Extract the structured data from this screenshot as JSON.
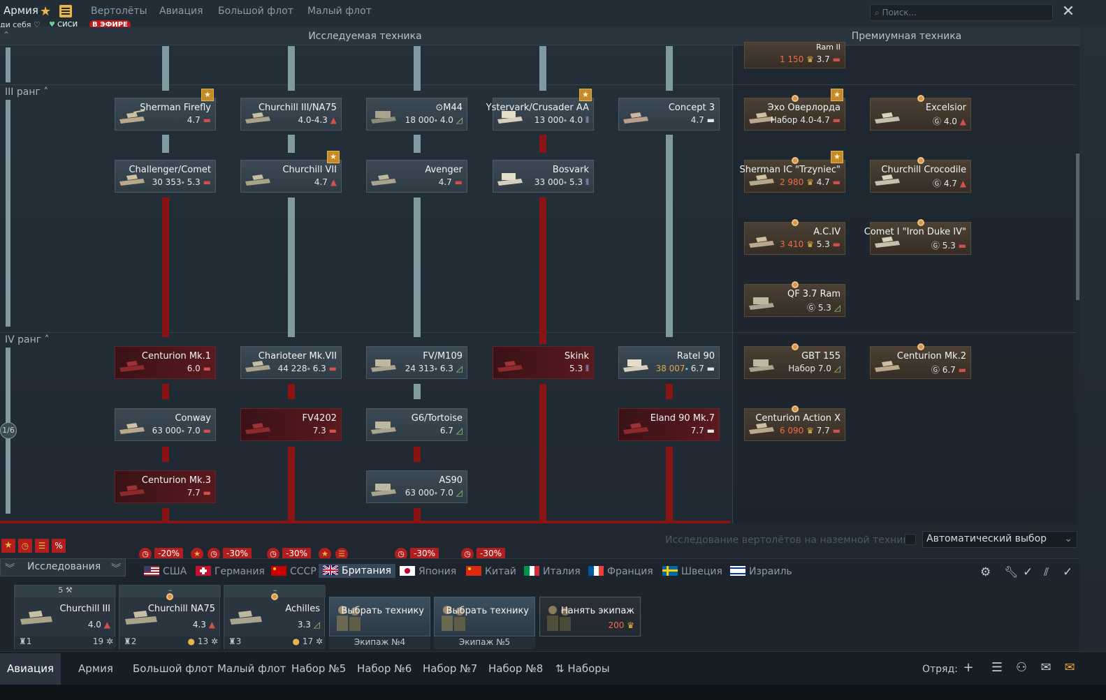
{
  "topbar": {
    "title": "Армия",
    "tabs": [
      "Вертолёты",
      "Авиация",
      "Большой флот",
      "Малый флот"
    ],
    "sub_left": "ди себя ♡",
    "chip_label": "СИСИ",
    "live_label": "В ЭФИРЕ",
    "search_placeholder": "Поиск..."
  },
  "headers": {
    "research": "Исследуемая техника",
    "premium": "Премиумная техника"
  },
  "ranks": {
    "r3": "III ранг",
    "r4": "IV ранг",
    "page_marker": "1/6"
  },
  "tree": [
    {
      "id": "firefly",
      "name": "Sherman Firefly",
      "cost": "",
      "br": "4.7",
      "state": "researched",
      "fav": true
    },
    {
      "id": "churchill3na75",
      "name": "Churchill III/NA75",
      "cost": "",
      "br": "4.0-4.3",
      "state": "researched"
    },
    {
      "id": "m44",
      "name": "M44",
      "cost": "18 000",
      "br": "4.0",
      "state": "normal"
    },
    {
      "id": "ystervark",
      "name": "Ystervark/Crusader AA",
      "cost": "13 000",
      "br": "4.0",
      "state": "normal",
      "fav": true
    },
    {
      "id": "concept3",
      "name": "Concept 3",
      "cost": "",
      "br": "4.7",
      "state": "researched"
    },
    {
      "id": "challenger",
      "name": "Challenger/Comet",
      "cost": "30 353",
      "br": "5.3",
      "state": "normal"
    },
    {
      "id": "churchill7",
      "name": "Churchill VII",
      "cost": "",
      "br": "4.7",
      "state": "researched",
      "fav": true
    },
    {
      "id": "avenger",
      "name": "Avenger",
      "cost": "",
      "br": "4.7",
      "state": "researched"
    },
    {
      "id": "bosvark",
      "name": "Bosvark",
      "cost": "33 000",
      "br": "5.3",
      "state": "normal"
    },
    {
      "id": "centurion1",
      "name": "Centurion Mk.1",
      "cost": "",
      "br": "6.0",
      "state": "locked"
    },
    {
      "id": "charioteer",
      "name": "Charioteer Mk.VII",
      "cost": "44 228",
      "br": "6.3",
      "state": "normal"
    },
    {
      "id": "fvm109",
      "name": "FV/M109",
      "cost": "24 313",
      "br": "6.3",
      "state": "normal"
    },
    {
      "id": "skink",
      "name": "Skink",
      "cost": "",
      "br": "5.3",
      "state": "locked"
    },
    {
      "id": "ratel90",
      "name": "Ratel 90",
      "cost": "38 007",
      "br": "6.7",
      "state": "normal"
    },
    {
      "id": "conway",
      "name": "Conway",
      "cost": "63 000",
      "br": "7.0",
      "state": "normal"
    },
    {
      "id": "fv4202",
      "name": "FV4202",
      "cost": "",
      "br": "7.3",
      "state": "locked"
    },
    {
      "id": "g6",
      "name": "G6/Tortoise",
      "cost": "",
      "br": "6.7",
      "state": "researched"
    },
    {
      "id": "eland",
      "name": "Eland 90 Mk.7",
      "cost": "",
      "br": "7.7",
      "state": "locked"
    },
    {
      "id": "centurion3",
      "name": "Centurion Mk.3",
      "cost": "",
      "br": "7.7",
      "state": "locked"
    },
    {
      "id": "as90",
      "name": "AS90",
      "cost": "63 000",
      "br": "7.0",
      "state": "normal"
    }
  ],
  "premium": [
    {
      "id": "ramii",
      "name": "Ram II",
      "cost": "1 150",
      "br": "3.7"
    },
    {
      "id": "echo",
      "name": "Эхо Оверлорда",
      "cost": "Набор",
      "br": "4.0-4.7",
      "fav": true
    },
    {
      "id": "excelsior",
      "name": "Excelsior",
      "cost": "Ⓖ",
      "br": "4.0"
    },
    {
      "id": "trzyniec",
      "name": "Sherman IC \"Trzyniec\"",
      "cost": "2 980",
      "br": "4.7",
      "fav": true
    },
    {
      "id": "crocodile",
      "name": "Churchill Crocodile",
      "cost": "Ⓖ",
      "br": "4.7"
    },
    {
      "id": "aciv",
      "name": "A.C.IV",
      "cost": "3 410",
      "br": "5.3"
    },
    {
      "id": "comet1",
      "name": "Comet I \"Iron Duke IV\"",
      "cost": "Ⓖ",
      "br": "5.3"
    },
    {
      "id": "qf37",
      "name": "QF 3.7 Ram",
      "cost": "Ⓖ",
      "br": "5.3"
    },
    {
      "id": "gbt155",
      "name": "GBT 155",
      "cost": "Набор",
      "br": "7.0"
    },
    {
      "id": "centurion2",
      "name": "Centurion Mk.2",
      "cost": "Ⓖ",
      "br": "6.7"
    },
    {
      "id": "actionx",
      "name": "Centurion Action X",
      "cost": "6 090",
      "br": "7.7"
    }
  ],
  "research_bar": {
    "auto_label": "Исследование вертолётов на наземной технике",
    "auto_select": "Автоматический выбор",
    "research_button": "Исследования"
  },
  "discounts": [
    "-20%",
    "-30%",
    "-30%",
    "-30%",
    "-30%"
  ],
  "nations": [
    "США",
    "Германия",
    "СССР",
    "Британия",
    "Япония",
    "Китай",
    "Италия",
    "Франция",
    "Швеция",
    "Израиль"
  ],
  "active_nation": "Британия",
  "crew_slots": [
    {
      "name": "Churchill III",
      "br": "4.0",
      "crew": "1",
      "top": "5",
      "count": "19"
    },
    {
      "name": "Churchill NA75",
      "br": "4.3",
      "crew": "2",
      "top": "–",
      "count": "13"
    },
    {
      "name": "Achilles",
      "br": "3.3",
      "crew": "3",
      "top": "–",
      "count": "17"
    }
  ],
  "crew_actions": [
    {
      "name": "Выбрать технику",
      "label": "Экипаж №4"
    },
    {
      "name": "Выбрать технику",
      "label": "Экипаж №5"
    },
    {
      "name": "Нанять экипаж",
      "cost": "200"
    }
  ],
  "bottom_nav": [
    "Авиация",
    "Армия",
    "Большой флот",
    "Малый флот",
    "Набор №5",
    "Набор №6",
    "Набор №7",
    "Набор №8",
    "Наборы"
  ],
  "squad_label": "Отряд:",
  "colors": {
    "locked": "#8a1414",
    "line": "#7f9aa0",
    "accent": "#b21e1e",
    "gold_cost": "#f26a4a"
  }
}
